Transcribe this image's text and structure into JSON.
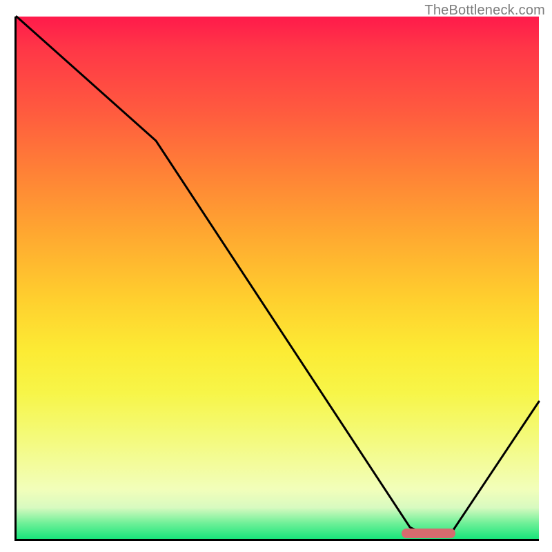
{
  "watermark": "TheBottleneck.com",
  "chart_data": {
    "type": "line",
    "title": "",
    "xlabel": "",
    "ylabel": "",
    "xlim": [
      0,
      100
    ],
    "ylim": [
      0,
      100
    ],
    "series": [
      {
        "name": "curve",
        "x": [
          0,
          27,
          75,
          83,
          100
        ],
        "y": [
          100,
          76,
          2,
          2,
          27
        ]
      }
    ],
    "marker": {
      "x_start": 74,
      "x_end": 84,
      "y": 1.5
    },
    "gradient_stops": [
      {
        "pct": 0,
        "color": "#ff1a4b"
      },
      {
        "pct": 6,
        "color": "#ff3647"
      },
      {
        "pct": 18,
        "color": "#ff5a3f"
      },
      {
        "pct": 30,
        "color": "#ff8236"
      },
      {
        "pct": 42,
        "color": "#ffa930"
      },
      {
        "pct": 54,
        "color": "#ffcf2e"
      },
      {
        "pct": 64,
        "color": "#fceb34"
      },
      {
        "pct": 72,
        "color": "#f7f548"
      },
      {
        "pct": 80,
        "color": "#f4fa77"
      },
      {
        "pct": 90.5,
        "color": "#f2feba"
      },
      {
        "pct": 94,
        "color": "#d8fac0"
      },
      {
        "pct": 97,
        "color": "#6ff098"
      },
      {
        "pct": 100,
        "color": "#18e57b"
      }
    ]
  }
}
